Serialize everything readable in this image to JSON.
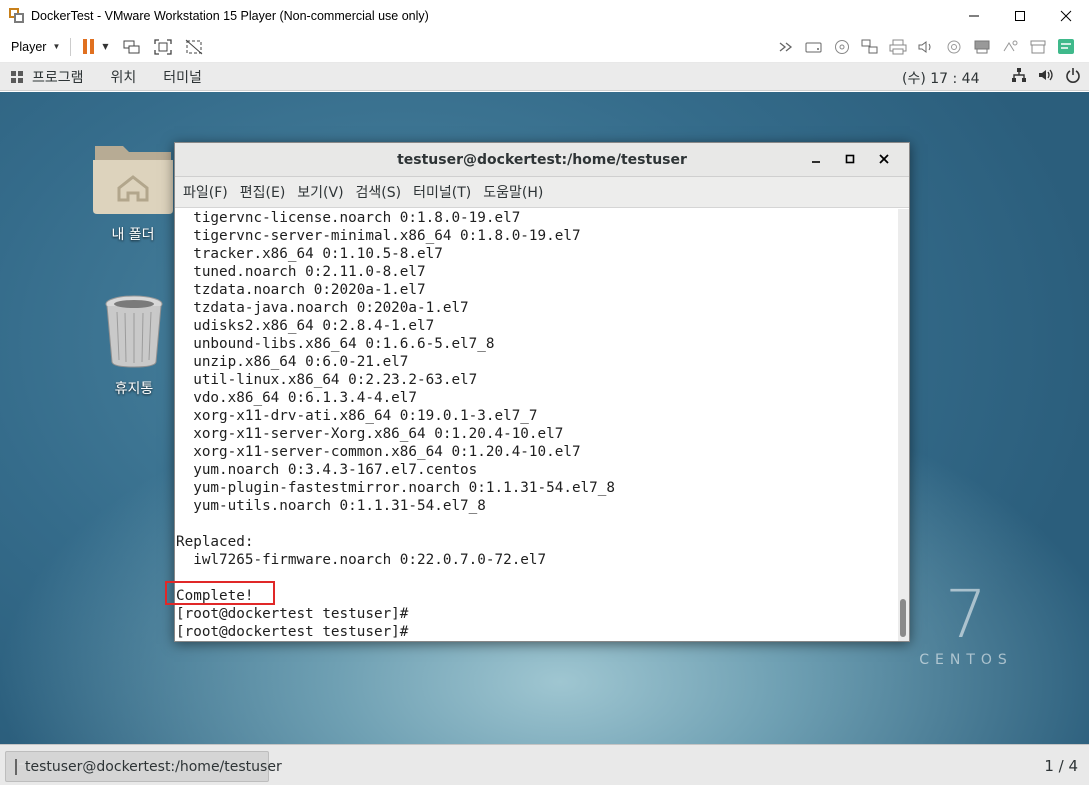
{
  "vmware": {
    "window_title": "DockerTest - VMware Workstation 15 Player (Non-commercial use only)",
    "player_menu_label": "Player",
    "controls": {
      "minimize": "—",
      "maximize": "☐",
      "close": "✕"
    }
  },
  "gnome_panel": {
    "menu_items": [
      "프로그램",
      "위치",
      "터미널"
    ],
    "clock": "(수) 17 : 44"
  },
  "desktop": {
    "icons": [
      {
        "label": "내 폴더",
        "icon": "home-folder-icon"
      },
      {
        "label": "휴지통",
        "icon": "trash-icon"
      }
    ],
    "branding": {
      "number": "7",
      "text": "CENTOS"
    }
  },
  "terminal": {
    "title": "testuser@dockertest:/home/testuser",
    "controls": {
      "minimize": "_",
      "maximize": "▫",
      "close": "✕"
    },
    "menu": [
      "파일(F)",
      "편집(E)",
      "보기(V)",
      "검색(S)",
      "터미널(T)",
      "도움말(H)"
    ],
    "lines": [
      "  tigervnc-license.noarch 0:1.8.0-19.el7",
      "  tigervnc-server-minimal.x86_64 0:1.8.0-19.el7",
      "  tracker.x86_64 0:1.10.5-8.el7",
      "  tuned.noarch 0:2.11.0-8.el7",
      "  tzdata.noarch 0:2020a-1.el7",
      "  tzdata-java.noarch 0:2020a-1.el7",
      "  udisks2.x86_64 0:2.8.4-1.el7",
      "  unbound-libs.x86_64 0:1.6.6-5.el7_8",
      "  unzip.x86_64 0:6.0-21.el7",
      "  util-linux.x86_64 0:2.23.2-63.el7",
      "  vdo.x86_64 0:6.1.3.4-4.el7",
      "  xorg-x11-drv-ati.x86_64 0:19.0.1-3.el7_7",
      "  xorg-x11-server-Xorg.x86_64 0:1.20.4-10.el7",
      "  xorg-x11-server-common.x86_64 0:1.20.4-10.el7",
      "  yum.noarch 0:3.4.3-167.el7.centos",
      "  yum-plugin-fastestmirror.noarch 0:1.1.31-54.el7_8",
      "  yum-utils.noarch 0:1.1.31-54.el7_8",
      "",
      "Replaced:",
      "  iwl7265-firmware.noarch 0:22.0.7.0-72.el7",
      "",
      "Complete!",
      "[root@dockertest testuser]#",
      "[root@dockertest testuser]#"
    ]
  },
  "taskbar": {
    "window_item": "testuser@dockertest:/home/testuser",
    "workspace": "1 / 4"
  }
}
